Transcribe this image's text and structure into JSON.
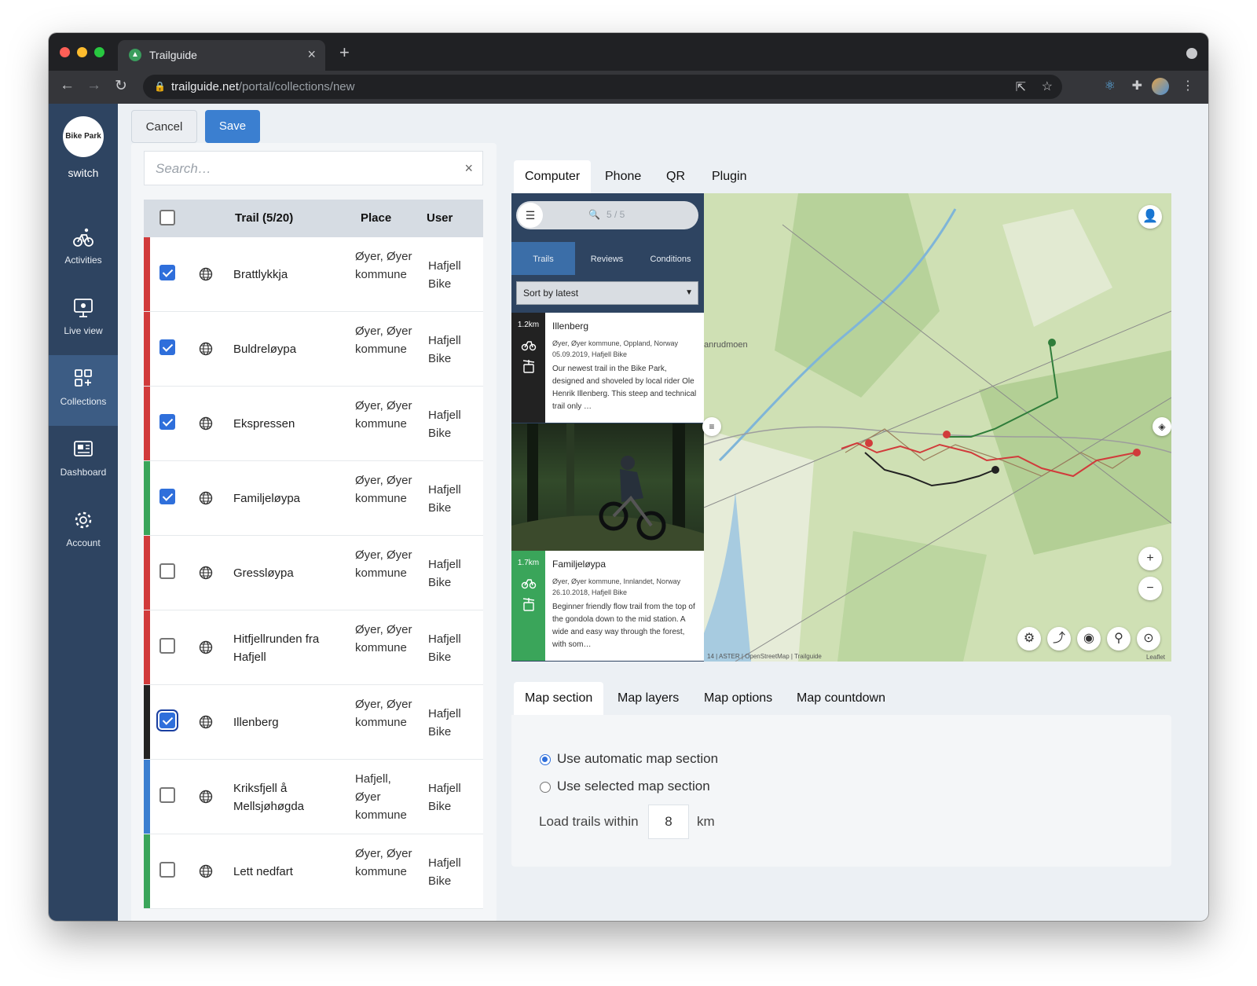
{
  "browser": {
    "tab_title": "Trailguide",
    "url_host": "trailguide.net",
    "url_path": "/portal/collections/new"
  },
  "sidebar": {
    "logo_text": "Bike Park",
    "switch_label": "switch",
    "items": [
      {
        "label": "Activities",
        "icon": "bike-icon"
      },
      {
        "label": "Live view",
        "icon": "monitor-icon"
      },
      {
        "label": "Collections",
        "icon": "collections-icon",
        "active": true
      },
      {
        "label": "Dashboard",
        "icon": "dashboard-icon"
      },
      {
        "label": "Account",
        "icon": "gear-icon"
      }
    ]
  },
  "actions": {
    "cancel": "Cancel",
    "save": "Save"
  },
  "search": {
    "placeholder": "Search…",
    "clear": "×"
  },
  "table": {
    "headers": {
      "trail": "Trail (5/20)",
      "place": "Place",
      "user": "User"
    },
    "rows": [
      {
        "name": "Brattlykkja",
        "place": "Øyer, Øyer kommune",
        "user": "Hafjell Bike",
        "checked": true,
        "color": "#d13b3b"
      },
      {
        "name": "Buldreløypa",
        "place": "Øyer, Øyer kommune",
        "user": "Hafjell Bike",
        "checked": true,
        "color": "#d13b3b"
      },
      {
        "name": "Ekspressen",
        "place": "Øyer, Øyer kommune",
        "user": "Hafjell Bike",
        "checked": true,
        "color": "#d13b3b"
      },
      {
        "name": "Familjeløypa",
        "place": "Øyer, Øyer kommune",
        "user": "Hafjell Bike",
        "checked": true,
        "color": "#3aa55a"
      },
      {
        "name": "Gressløypa",
        "place": "Øyer, Øyer kommune",
        "user": "Hafjell Bike",
        "checked": false,
        "color": "#d13b3b"
      },
      {
        "name": "Hitfjellrunden fra Hafjell",
        "place": "Øyer, Øyer kommune",
        "user": "Hafjell Bike",
        "checked": false,
        "color": "#d13b3b"
      },
      {
        "name": "Illenberg",
        "place": "Øyer, Øyer kommune",
        "user": "Hafjell Bike",
        "checked": true,
        "color": "#222222"
      },
      {
        "name": "Kriksfjell å Mellsjøhøgda",
        "place": "Hafjell, Øyer kommune",
        "user": "Hafjell Bike",
        "checked": false,
        "color": "#3b7fd0"
      },
      {
        "name": "Lett nedfart",
        "place": "Øyer, Øyer kommune",
        "user": "Hafjell Bike",
        "checked": false,
        "color": "#3aa55a"
      }
    ]
  },
  "preview_tabs": [
    "Computer",
    "Phone",
    "QR",
    "Plugin"
  ],
  "preview": {
    "count": "5 / 5",
    "list_tabs": [
      "Trails",
      "Reviews",
      "Conditions"
    ],
    "sort": "Sort by latest",
    "cards": [
      {
        "km": "1.2km",
        "title": "Illenberg",
        "meta1": "Øyer, Øyer kommune, Oppland, Norway",
        "meta2": "05.09.2019, Hafjell Bike",
        "desc": "Our newest trail in the Bike Park, designed and shoveled by local rider Ole Henrik Illenberg. This steep and technical trail only …",
        "color": "#222222"
      },
      {
        "km": "1.7km",
        "title": "Familjeløypa",
        "meta1": "Øyer, Øyer kommune, Innlandet, Norway",
        "meta2": "26.10.2018, Hafjell Bike",
        "desc": "Beginner friendly flow trail from the top of the gondola down to the mid station. A wide and easy way through the forest, with som…",
        "color": "#3aa55a"
      }
    ],
    "map_place_label": "anrudmoen",
    "attribution": "14 | ASTER | OpenStreetMap | Trailguide",
    "leaflet": "Leaflet"
  },
  "settings_tabs": [
    "Map section",
    "Map layers",
    "Map options",
    "Map countdown"
  ],
  "settings": {
    "option_auto": "Use automatic map section",
    "option_selected": "Use selected map section",
    "load_label": "Load trails within",
    "load_value": "8",
    "unit": "km"
  }
}
